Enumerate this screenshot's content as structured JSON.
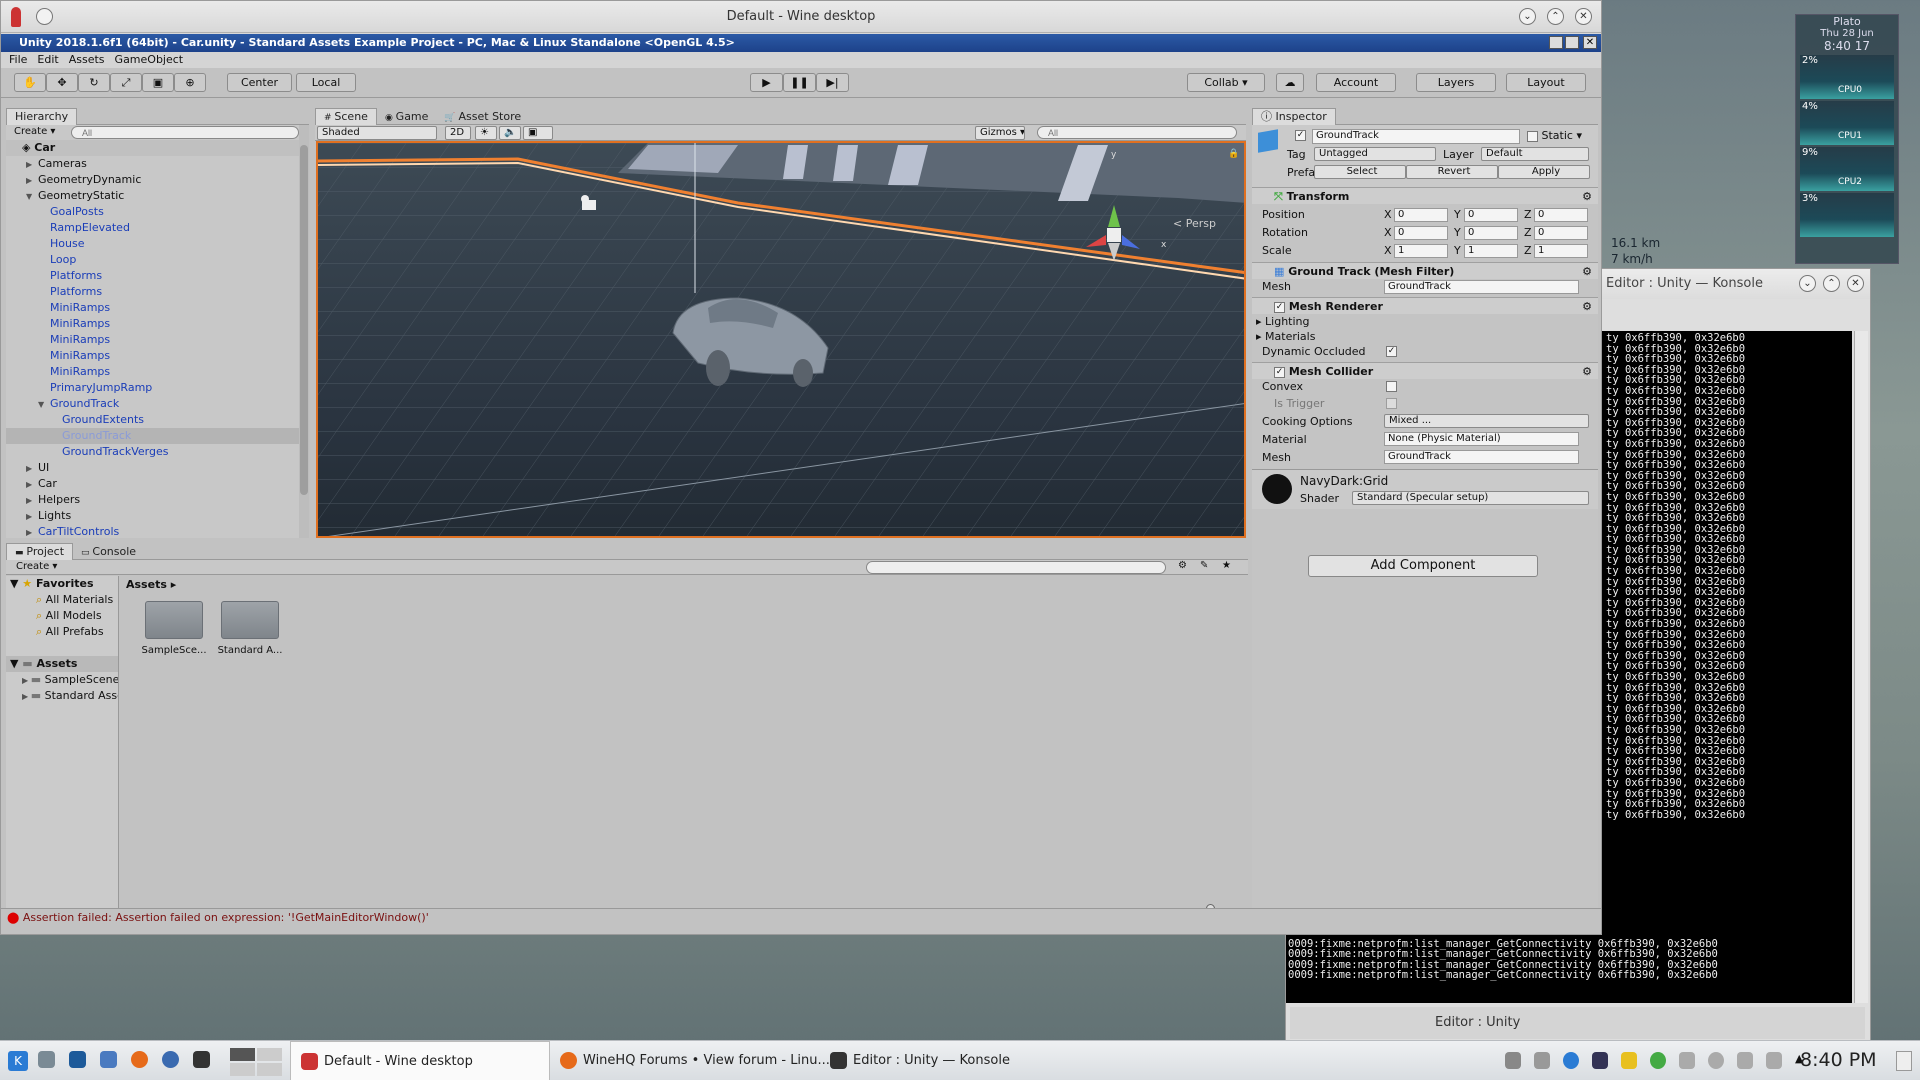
{
  "wine_window": {
    "title": "Default - Wine desktop"
  },
  "unity": {
    "title": "Unity 2018.1.6f1 (64bit) - Car.unity - Standard Assets Example Project - PC, Mac & Linux Standalone <OpenGL 4.5>",
    "menu": [
      "File",
      "Edit",
      "Assets",
      "GameObject"
    ],
    "toolbar": {
      "center": "Center",
      "local": "Local",
      "collab": "Collab ▾",
      "account": "Account",
      "layers": "Layers",
      "layout": "Layout"
    },
    "hierarchy": {
      "tab": "Hierarchy",
      "create": "Create ▾",
      "search_placeholder": "All",
      "scene": "Car",
      "items": [
        {
          "label": "Cameras",
          "indent": 1,
          "arrow": "▶",
          "blue": false
        },
        {
          "label": "GeometryDynamic",
          "indent": 1,
          "arrow": "▶",
          "blue": false
        },
        {
          "label": "GeometryStatic",
          "indent": 1,
          "arrow": "▼",
          "blue": false
        },
        {
          "label": "GoalPosts",
          "indent": 2,
          "arrow": "",
          "blue": true
        },
        {
          "label": "RampElevated",
          "indent": 2,
          "arrow": "",
          "blue": true
        },
        {
          "label": "House",
          "indent": 2,
          "arrow": "",
          "blue": true
        },
        {
          "label": "Loop",
          "indent": 2,
          "arrow": "",
          "blue": true
        },
        {
          "label": "Platforms",
          "indent": 2,
          "arrow": "",
          "blue": true
        },
        {
          "label": "Platforms",
          "indent": 2,
          "arrow": "",
          "blue": true
        },
        {
          "label": "MiniRamps",
          "indent": 2,
          "arrow": "",
          "blue": true
        },
        {
          "label": "MiniRamps",
          "indent": 2,
          "arrow": "",
          "blue": true
        },
        {
          "label": "MiniRamps",
          "indent": 2,
          "arrow": "",
          "blue": true
        },
        {
          "label": "MiniRamps",
          "indent": 2,
          "arrow": "",
          "blue": true
        },
        {
          "label": "MiniRamps",
          "indent": 2,
          "arrow": "",
          "blue": true
        },
        {
          "label": "PrimaryJumpRamp",
          "indent": 2,
          "arrow": "",
          "blue": true
        },
        {
          "label": "GroundTrack",
          "indent": 2,
          "arrow": "▼",
          "blue": true
        },
        {
          "label": "GroundExtents",
          "indent": 3,
          "arrow": "",
          "blue": true
        },
        {
          "label": "GroundTrack",
          "indent": 3,
          "arrow": "",
          "blue": true,
          "selected": true
        },
        {
          "label": "GroundTrackVerges",
          "indent": 3,
          "arrow": "",
          "blue": true
        },
        {
          "label": "UI",
          "indent": 1,
          "arrow": "▶",
          "blue": false
        },
        {
          "label": "Car",
          "indent": 1,
          "arrow": "▶",
          "blue": false
        },
        {
          "label": "Helpers",
          "indent": 1,
          "arrow": "▶",
          "blue": false
        },
        {
          "label": "Lights",
          "indent": 1,
          "arrow": "▶",
          "blue": false
        },
        {
          "label": "CarTiltControls",
          "indent": 1,
          "arrow": "▶",
          "blue": true
        }
      ]
    },
    "scene": {
      "tabs": [
        "Scene",
        "Game",
        "Asset Store"
      ],
      "shaded": "Shaded",
      "mode_2d": "2D",
      "gizmos": "Gizmos ▾",
      "search_placeholder": "All",
      "persp": "< Persp",
      "axis_y": "y",
      "axis_x": "x"
    },
    "project": {
      "tabs": [
        "Project",
        "Console"
      ],
      "create": "Create ▾",
      "breadcrumb": "Assets ▸",
      "favorites_label": "Favorites",
      "favorites": [
        "All Materials",
        "All Models",
        "All Prefabs"
      ],
      "assets_label": "Assets",
      "asset_tree": [
        "SampleScenes",
        "Standard Assets"
      ],
      "folders": [
        "SampleSce...",
        "Standard A..."
      ]
    },
    "status": "Assertion failed: Assertion failed on expression: '!GetMainEditorWindow()'",
    "inspector": {
      "tab": "Inspector",
      "object_name": "GroundTrack",
      "static": "Static",
      "tag_label": "Tag",
      "tag": "Untagged",
      "layer_label": "Layer",
      "layer": "Default",
      "prefab_label": "Prefab",
      "prefab_select": "Select",
      "prefab_revert": "Revert",
      "prefab_apply": "Apply",
      "transform": {
        "title": "Transform",
        "rows": [
          {
            "label": "Position",
            "x": "0",
            "y": "0",
            "z": "0"
          },
          {
            "label": "Rotation",
            "x": "0",
            "y": "0",
            "z": "0"
          },
          {
            "label": "Scale",
            "x": "1",
            "y": "1",
            "z": "1"
          }
        ]
      },
      "mesh_filter": {
        "title": "Ground Track (Mesh Filter)",
        "mesh_label": "Mesh",
        "mesh": "GroundTrack"
      },
      "mesh_renderer": {
        "title": "Mesh Renderer",
        "lighting": "Lighting",
        "materials": "Materials",
        "dynamic_occluded": "Dynamic Occluded"
      },
      "mesh_collider": {
        "title": "Mesh Collider",
        "convex": "Convex",
        "is_trigger": "Is Trigger",
        "cooking_label": "Cooking Options",
        "cooking": "Mixed ...",
        "material_label": "Material",
        "material": "None (Physic Material)",
        "mesh_label": "Mesh",
        "mesh": "GroundTrack"
      },
      "material_block": {
        "name": "NavyDark:Grid",
        "shader_label": "Shader",
        "shader": "Standard (Specular setup)"
      },
      "add_component": "Add Component"
    }
  },
  "konsole": {
    "title": "Editor : Unity — Konsole",
    "line_tail": "ty 0x6ffb390, 0x32e6b0",
    "tail_lines": [
      "0009:fixme:netprofm:list_manager_GetConnectivity 0x6ffb390, 0x32e6b0",
      "0009:fixme:netprofm:list_manager_GetConnectivity 0x6ffb390, 0x32e6b0",
      "0009:fixme:netprofm:list_manager_GetConnectivity 0x6ffb390, 0x32e6b0",
      "0009:fixme:netprofm:list_manager_GetConnectivity 0x6ffb390, 0x32e6b0"
    ],
    "tab": "Editor : Unity"
  },
  "widget": {
    "name": "Plato",
    "date": "Thu 28 Jun",
    "time": "8:40 17",
    "rows": [
      {
        "pct": "2%",
        "label": "CPU0"
      },
      {
        "pct": "4%",
        "label": "CPU1"
      },
      {
        "pct": "9%",
        "label": "CPU2"
      },
      {
        "pct": "3%",
        "label": ""
      }
    ]
  },
  "speed": {
    "km": "16.1 km",
    "kmh": "7 km/h"
  },
  "taskbar": {
    "items": [
      "Default - Wine desktop",
      "WineHQ Forums • View forum - Linu...",
      "Editor : Unity — Konsole"
    ],
    "clock": "8:40 PM"
  }
}
